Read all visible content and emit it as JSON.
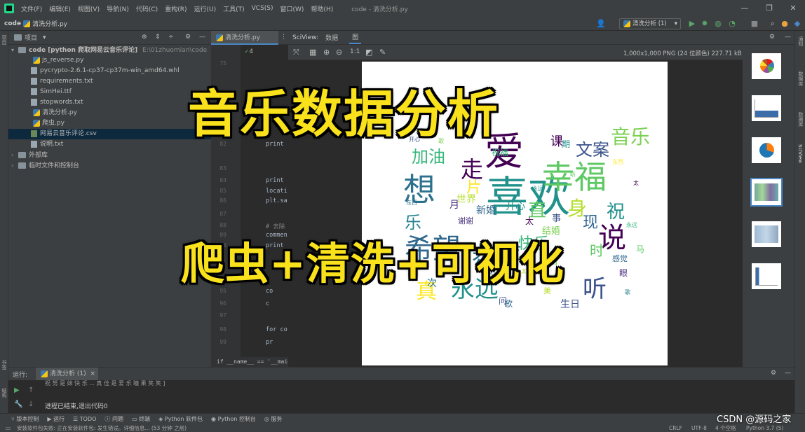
{
  "titlebar": {
    "menu": [
      "文件(F)",
      "编辑(E)",
      "视图(V)",
      "导航(N)",
      "代码(C)",
      "重构(R)",
      "运行(U)",
      "工具(T)",
      "VCS(S)",
      "窗口(W)",
      "帮助(H)"
    ],
    "title": "code - 清洗分析.py"
  },
  "navbar": {
    "root": "code",
    "file": "清洗分析.py",
    "run_config": "清洗分析 (1)"
  },
  "project": {
    "header": "项目",
    "root_label": "code [python 爬取网易云音乐评论]",
    "root_path": "E:\\01zhuomian\\code",
    "files": [
      "js_reverse.py",
      "pycrypto-2.6.1-cp37-cp37m-win_amd64.whl",
      "requirements.txt",
      "SimHei.ttf",
      "stopwords.txt",
      "清洗分析.py",
      "爬虫.py",
      "网易云音乐评论.csv",
      "说明.txt"
    ],
    "selected_index": 7,
    "external_libs": "外部库",
    "scratches": "临时文件和控制台"
  },
  "editor": {
    "tab": "清洗分析.py",
    "warnings": "1",
    "weak_warnings": "4",
    "checks": "4",
    "lines": [
      {
        "n": "75",
        "t": ""
      },
      {
        "n": "82",
        "t": "print"
      },
      {
        "n": "83",
        "t": ""
      },
      {
        "n": "84",
        "t": "print"
      },
      {
        "n": "85",
        "t": "locati"
      },
      {
        "n": "86",
        "t": "plt.sa"
      },
      {
        "n": "87",
        "t": ""
      },
      {
        "n": "88",
        "t": "# 去除"
      },
      {
        "n": "89",
        "t": "commen"
      },
      {
        "n": "90",
        "t": "print"
      },
      {
        "n": "95",
        "t": "co"
      },
      {
        "n": "96",
        "t": "c"
      },
      {
        "n": "97",
        "t": ""
      },
      {
        "n": "98",
        "t": "for co"
      },
      {
        "n": "99",
        "t": "pr"
      }
    ],
    "footer": "if __name__ == '__main__'"
  },
  "sciview": {
    "label": "SciView:",
    "tab_data": "数据",
    "tab_plots": "图",
    "image_info": "1,000x1,000 PNG (24 位颜色) 227.71 kB"
  },
  "overlay": {
    "title": "音乐数据分析",
    "subtitle": "爬虫+清洗+可视化"
  },
  "wordcloud": {
    "words": [
      "喜欢",
      "爱",
      "幸福",
      "想",
      "说",
      "听",
      "音乐",
      "希望",
      "身",
      "祝",
      "现",
      "恭喜",
      "永远",
      "直",
      "走",
      "加油",
      "文案",
      "真",
      "快乐",
      "开心",
      "生日",
      "新婚",
      "谢谢",
      "世界",
      "时",
      "结婚",
      "歌",
      "月",
      "片",
      "问",
      "课",
      "期",
      "祝福",
      "东西",
      "事",
      "马",
      "眼",
      "次",
      "乐",
      "美",
      "太",
      "感觉"
    ]
  },
  "run": {
    "label": "运行:",
    "tab": "清洗分析 (1)",
    "truncated_line": "祝 努 是 妹 快 乐 ...     真 佳 是      爱 乐      瞳 果 笑 笑 ]",
    "exit_line": "进程已结束,退出代码0"
  },
  "tool_windows": [
    "版本控制",
    "运行",
    "TODO",
    "问题",
    "终端",
    "Python 软件包",
    "Python 控制台",
    "服务"
  ],
  "status": {
    "left": "安装软件包失败: 正在安装软件包: 发生错误。详细信息... (53 分钟 之前)",
    "right": [
      "CRLF",
      "UTF-8",
      "4 个空格",
      "Python 3.7 (5)"
    ]
  },
  "watermark": "CSDN @源码之家",
  "right_stripe": [
    "通知",
    "数据库",
    "数据库",
    "SciView"
  ],
  "left_stripe": [
    "项目",
    "书签",
    "结构"
  ],
  "colors": {
    "overlay_yellow": "#f9e21c",
    "selection": "#0d293e",
    "accent": "#4a88c7"
  }
}
